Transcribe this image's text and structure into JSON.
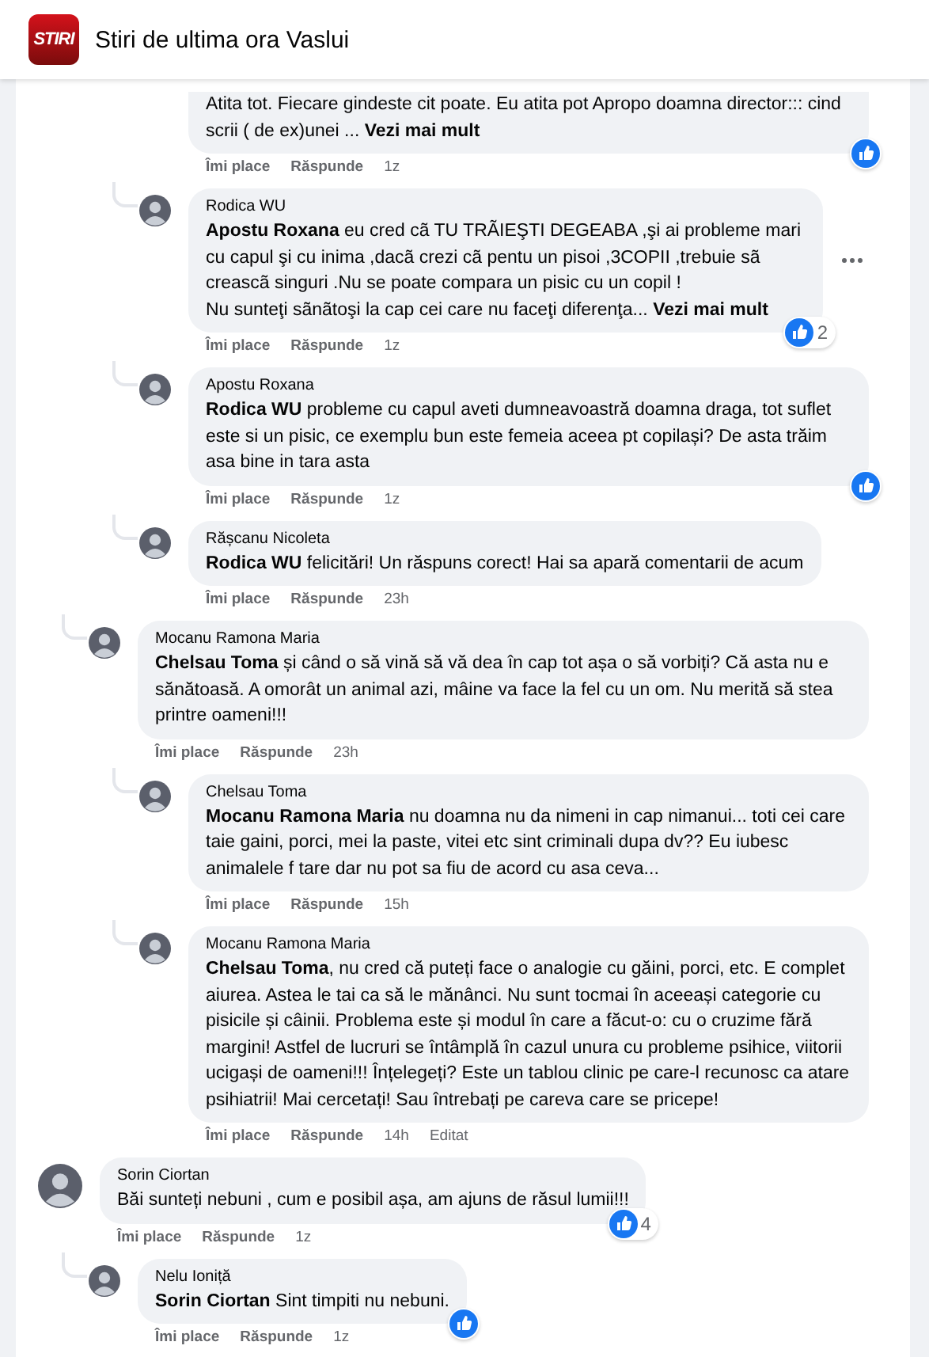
{
  "header": {
    "logo_text": "STIRI",
    "title": "Stiri de ultima ora Vaslui"
  },
  "comments": [
    {
      "replies": [
        {
          "replies": [
            {
              "lines": [
                "Atita tot. Fiecare gindeste cit poate. Eu atita pot Apropo doamna director::: cind scrii ( de ex)unei ... **Vezi mai mult**"
              ],
              "like": "Îmi place",
              "reply": "Răspunde",
              "time": "1z",
              "reaction": true,
              "more_menu": false
            },
            {
              "author": "Rodica WU",
              "lines": [
                "**Apostu Roxana** eu cred cã TU TRÃIEŞTI DEGEABA ,şi ai probleme mari cu capul şi cu inima ,dacã crezi cã pentu un pisoi ,3COPII ,trebuie sã creascã singuri .Nu se poate compara un pisic cu un copil !",
                "Nu sunteţi sãnãtoşi la cap cei care nu faceţi diferenţa... **Vezi mai mult**"
              ],
              "like": "Îmi place",
              "reply": "Răspunde",
              "time": "1z",
              "reaction": true,
              "reaction_count": "2",
              "more_menu": true
            },
            {
              "author": "Apostu Roxana",
              "lines": [
                "**Rodica WU** probleme cu capul aveti dumneavoastră doamna draga, tot suflet este si un pisic, ce exemplu bun este femeia aceea pt copilași? De asta trăim asa bine in tara asta"
              ],
              "like": "Îmi place",
              "reply": "Răspunde",
              "time": "1z",
              "reaction": true,
              "more_menu": false
            },
            {
              "author": "Rășcanu Nicoleta",
              "lines": [
                "**Rodica WU** felicitări! Un răspuns corect! Hai sa apară comentarii de acum"
              ],
              "like": "Îmi place",
              "reply": "Răspunde",
              "time": "23h",
              "reaction": false,
              "more_menu": false
            }
          ]
        },
        {
          "author": "Mocanu Ramona Maria",
          "lines": [
            "**Chelsau Toma** și când o să vină să vă dea în cap tot așa o să vorbiți? Că asta nu e sănătoasă. A omorât un animal azi, mâine va face la fel cu un om. Nu merită să stea printre oameni!!!"
          ],
          "like": "Îmi place",
          "reply": "Răspunde",
          "time": "23h",
          "reaction": false,
          "more_menu": false,
          "replies": [
            {
              "author": "Chelsau Toma",
              "lines": [
                "**Mocanu Ramona Maria** nu doamna nu da nimeni in cap nimanui... toti cei care taie gaini, porci, mei la paste, vitei etc sint criminali dupa dv?? Eu iubesc animalele f tare dar nu pot sa fiu de acord cu asa ceva..."
              ],
              "like": "Îmi place",
              "reply": "Răspunde",
              "time": "15h",
              "reaction": false,
              "more_menu": false
            },
            {
              "author": "Mocanu Ramona Maria",
              "lines": [
                "**Chelsau Toma**, nu cred că puteți face o analogie cu găini, porci, etc. E complet aiurea. Astea le tai ca să le mănânci. Nu sunt tocmai în aceeași categorie cu pisicile și câinii. Problema este și modul în care a făcut-o: cu o cruzime fără margini! Astfel de lucruri se întâmplă în cazul unura cu probleme psihice, viitorii ucigași de oameni!!! Înțelegeți? Este un tablou clinic pe care-l recunosc ca atare psihiatrii! Mai cercetați! Sau întrebați pe careva care se pricepe!"
              ],
              "like": "Îmi place",
              "reply": "Răspunde",
              "time": "14h",
              "edited": "Editat",
              "reaction": false,
              "more_menu": false
            }
          ]
        }
      ]
    },
    {
      "author": "Sorin Ciortan",
      "lines": [
        "Băi sunteți nebuni , cum e posibil așa, am ajuns de răsul lumii!!!"
      ],
      "like": "Îmi place",
      "reply": "Răspunde",
      "time": "1z",
      "reaction": true,
      "reaction_count": "4",
      "more_menu": false,
      "replies": [
        {
          "author": "Nelu Ioniță",
          "lines": [
            "**Sorin Ciortan** Sint timpiti nu nebuni."
          ],
          "like": "Îmi place",
          "reply": "Răspunde",
          "time": "1z",
          "reaction": true,
          "more_menu": false
        }
      ]
    }
  ]
}
